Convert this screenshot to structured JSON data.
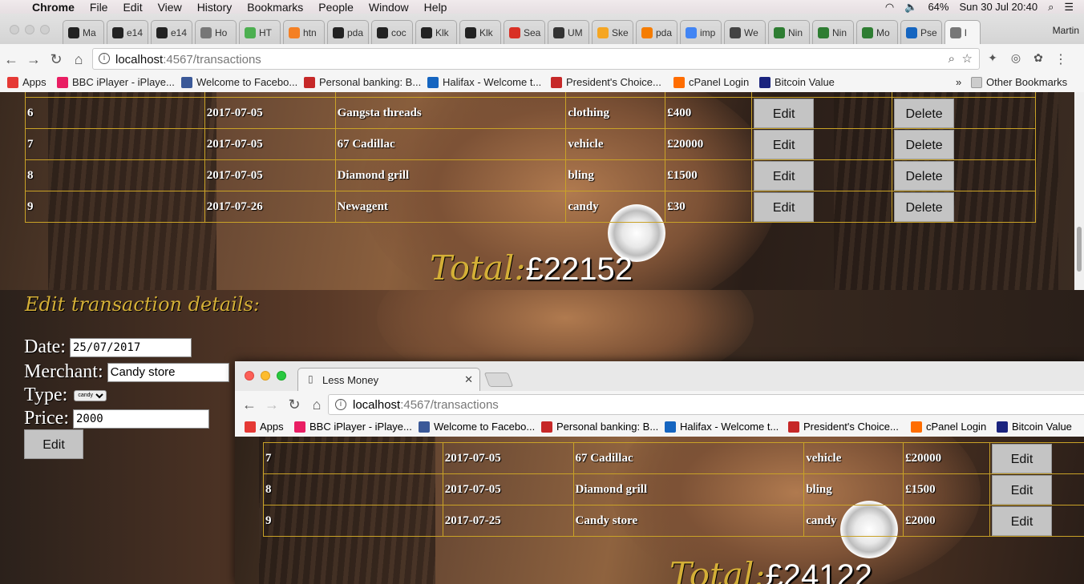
{
  "menubar": {
    "app": "Chrome",
    "items": [
      "File",
      "Edit",
      "View",
      "History",
      "Bookmarks",
      "People",
      "Window",
      "Help"
    ],
    "battery": "64%",
    "datetime": "Sun 30 Jul  20:40"
  },
  "browser": {
    "tabs": [
      "Ma",
      "e14",
      "e14",
      "Ho",
      "HT",
      "htn",
      "pda",
      "coc",
      "Klk",
      "Klk",
      "Sea",
      "UM",
      "Ske",
      "pda",
      "imp",
      "We",
      "Nin",
      "Nin",
      "Mo",
      "Pse",
      "l"
    ],
    "profile": "Martin",
    "url_host": "localhost",
    "url_path": ":4567/transactions",
    "bookmarks": [
      "Apps",
      "BBC iPlayer - iPlaye...",
      "Welcome to Facebo...",
      "Personal banking: B...",
      "Halifax - Welcome t...",
      "President's Choice...",
      "cPanel Login",
      "Bitcoin Value"
    ],
    "other_bookmarks": "Other Bookmarks"
  },
  "main": {
    "rows": [
      {
        "id": "6",
        "date": "2017-07-05",
        "merchant": "Gangsta threads",
        "type": "clothing",
        "amount": "£400"
      },
      {
        "id": "7",
        "date": "2017-07-05",
        "merchant": "67 Cadillac",
        "type": "vehicle",
        "amount": "£20000"
      },
      {
        "id": "8",
        "date": "2017-07-05",
        "merchant": "Diamond grill",
        "type": "bling",
        "amount": "£1500"
      },
      {
        "id": "9",
        "date": "2017-07-26",
        "merchant": "Newagent",
        "type": "candy",
        "amount": "£30"
      }
    ],
    "edit_label": "Edit",
    "delete_label": "Delete",
    "total_label": "Total:",
    "total_value": "£22152"
  },
  "edit_form": {
    "title": "Edit transaction details:",
    "date_label": "Date:",
    "date_value": "25/07/2017",
    "merchant_label": "Merchant:",
    "merchant_value": "Candy store",
    "type_label": "Type:",
    "type_value": "candy",
    "price_label": "Price:",
    "price_value": "2000",
    "submit_label": "Edit"
  },
  "second_window": {
    "tab_title": "Less Money",
    "url_host": "localhost",
    "url_path": ":4567/transactions",
    "bookmarks": [
      "Apps",
      "BBC iPlayer - iPlaye...",
      "Welcome to Facebo...",
      "Personal banking: B...",
      "Halifax - Welcome t...",
      "President's Choice...",
      "cPanel Login",
      "Bitcoin Value"
    ],
    "rows": [
      {
        "id": "7",
        "date": "2017-07-05",
        "merchant": "67 Cadillac",
        "type": "vehicle",
        "amount": "£20000"
      },
      {
        "id": "8",
        "date": "2017-07-05",
        "merchant": "Diamond grill",
        "type": "bling",
        "amount": "£1500"
      },
      {
        "id": "9",
        "date": "2017-07-25",
        "merchant": "Candy store",
        "type": "candy",
        "amount": "£2000"
      }
    ],
    "edit_label": "Edit",
    "total_label": "Total:",
    "total_value": "£24122"
  },
  "colors": {
    "accent_gold": "#c9a227",
    "button_gray": "#c4c4c4"
  }
}
